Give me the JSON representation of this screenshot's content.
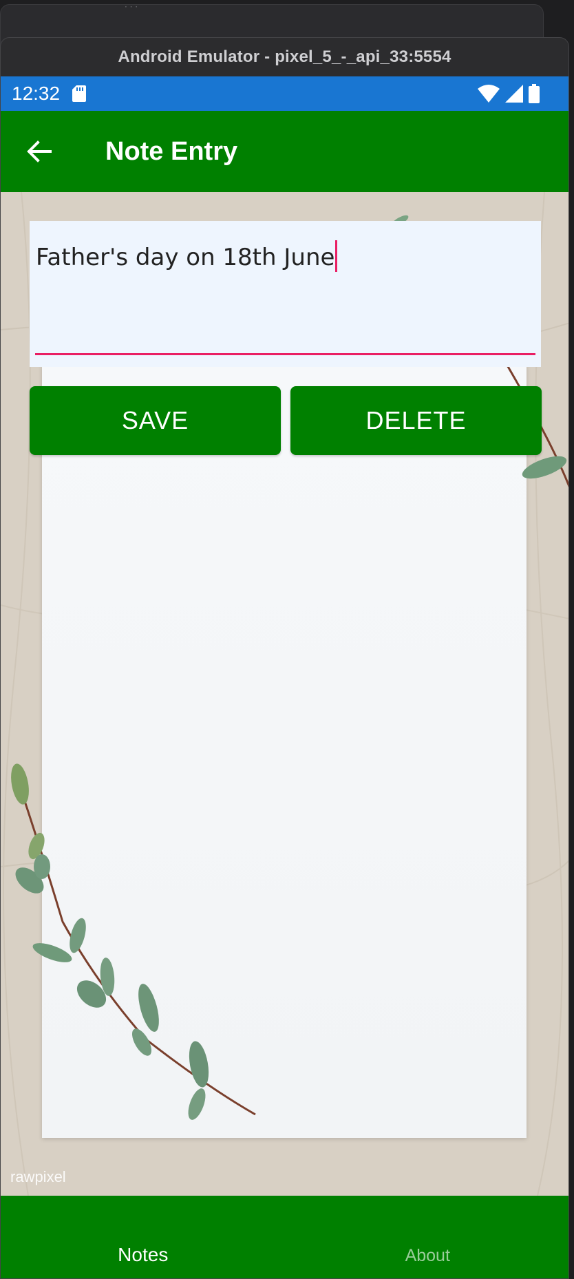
{
  "emulator": {
    "title": "Android Emulator - pixel_5_-_api_33:5554"
  },
  "statusbar": {
    "time": "12:32",
    "icons": [
      "sd-card-icon",
      "wifi-icon",
      "signal-icon",
      "battery-icon"
    ]
  },
  "appbar": {
    "title": "Note Entry",
    "back_icon": "arrow-left-icon"
  },
  "editor": {
    "value": "Father's day on 18th June"
  },
  "actions": {
    "save_label": "SAVE",
    "delete_label": "DELETE"
  },
  "background": {
    "watermark": "rawpixel"
  },
  "bottom_nav": {
    "tabs": [
      {
        "label": "Notes",
        "active": true
      },
      {
        "label": "About",
        "active": false
      }
    ]
  },
  "colors": {
    "primary": "#008000",
    "statusbar": "#1976d2",
    "accent": "#e91e63",
    "editor_bg": "#eef5fe"
  }
}
